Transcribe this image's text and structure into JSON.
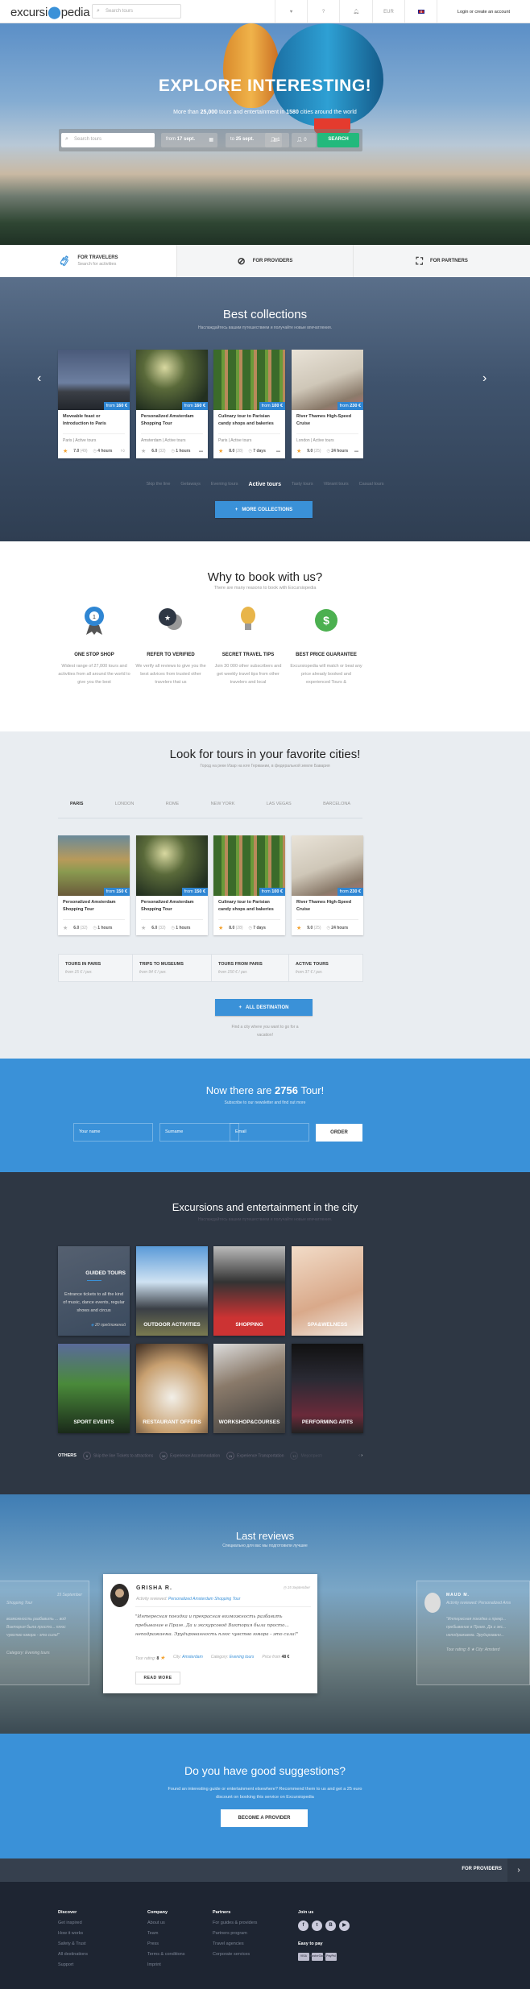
{
  "colors": {
    "accent": "#3a91d8",
    "search_button": "#23b97c",
    "dark_section": "#2e3744",
    "footer": "#1e2532",
    "star": "#f3a230"
  },
  "header": {
    "logo": "excursiopedia",
    "search_placeholder": "Search tours",
    "icons": [
      "heart-icon",
      "help-icon",
      "bell-icon"
    ],
    "currency": "EUR",
    "language_icon": "uk-flag-icon",
    "login": "Login or create an account"
  },
  "hero": {
    "title": "EXPLORE INTERESTING!",
    "subtitle_parts": [
      "More than ",
      "25,000",
      " tours and entertainment in ",
      "1580",
      " cities around the world"
    ],
    "search_placeholder": "Search tours",
    "from_label": "from",
    "from_date": "17 sept.",
    "to_label": "to",
    "to_date": "25 sept.",
    "adults": "1",
    "children": "0",
    "search_button": "SEARCH"
  },
  "tabs": [
    {
      "title": "FOR TRAVELERS",
      "sub": "Search for activities",
      "icon": "briefcase-icon",
      "active": true
    },
    {
      "title": "FOR PROVIDERS",
      "icon": "compass-icon"
    },
    {
      "title": "FOR PARTNERS",
      "icon": "frame-icon"
    }
  ],
  "collections": {
    "title": "Best collections",
    "subtitle": "Наслаждайтесь вашим путешествием и получайте новые впечатления.",
    "cards": [
      {
        "title": "Moveable feast or Introduction to Paris",
        "price_from": "from",
        "price": "160 €",
        "city": "Paris",
        "category": "Active tours",
        "rating": "7.0",
        "reviews": "(49)",
        "duration": "4 hours",
        "star_active": true
      },
      {
        "title": "Personalized Amsterdam Shopping Tour",
        "price_from": "from",
        "price": "160 €",
        "city": "Amsterdam",
        "category": "Active tours",
        "rating": "6.0",
        "reviews": "(32)",
        "duration": "1 hours",
        "star_active": false
      },
      {
        "title": "Culinary tour to Parisian candy shops and bakeries",
        "price_from": "from",
        "price": "100 €",
        "city": "Paris",
        "category": "Active tours",
        "rating": "8.0",
        "reviews": "(28)",
        "duration": "7 days",
        "star_active": true
      },
      {
        "title": "River Thames High-Speed Cruise",
        "price_from": "from",
        "price": "230 €",
        "city": "London",
        "category": "Active tours",
        "rating": "9.0",
        "reviews": "(25)",
        "duration": "24 hours",
        "star_active": true
      }
    ],
    "categories": [
      "Skip the line",
      "Getaways",
      "Evening tours",
      "Active tours",
      "Tasty tours",
      "Vibrant tours",
      "Casual tours"
    ],
    "active_category": "Active tours",
    "more_button": "MORE COLLECTIONS"
  },
  "why": {
    "title": "Why to book with us?",
    "subtitle": "There are many reasons to book with Excursiopedia",
    "items": [
      {
        "title": "ONE STOP SHOP",
        "desc": "Widest range of 27,000 tours and activities from all around the world to give you the best",
        "icon": "ribbon-badge-icon"
      },
      {
        "title": "REFER TO VERIFIED",
        "desc": "We verify all reviews to give you the best advices from trusted other travelers that us",
        "icon": "chat-star-icon"
      },
      {
        "title": "SECRET TRAVEL TIPS",
        "desc": "Join 30 000 other subscribers and get weekly travel tips from other travelers and local",
        "icon": "lightbulb-icon"
      },
      {
        "title": "BEST PRICE GUARANTEE",
        "desc": "Excursiopedia will match or beat any price already booked and experienced Tours &",
        "icon": "dollar-badge-icon"
      }
    ]
  },
  "cities": {
    "title": "Look for tours in your favorite cities!",
    "subtitle": "Город на реке Изар на юге Германии, в федеральной земле Бавария",
    "tabs": [
      "PARIS",
      "LONDON",
      "ROME",
      "NEW YORK",
      "LAS VEGAS",
      "BARCELONA"
    ],
    "active_tab": "PARIS",
    "cards": [
      {
        "title": "Personalized Amsterdam Shopping Tour",
        "price_from": "from",
        "price": "150 €",
        "rating": "6.0",
        "reviews": "(32)",
        "duration": "1 hours",
        "star_active": false
      },
      {
        "title": "Personalized Amsterdam Shopping Tour",
        "price_from": "from",
        "price": "150 €",
        "rating": "6.0",
        "reviews": "(32)",
        "duration": "1 hours",
        "star_active": false
      },
      {
        "title": "Culinary tour to Parisian candy shops and bakeries",
        "price_from": "from",
        "price": "100 €",
        "rating": "8.0",
        "reviews": "(28)",
        "duration": "7 days",
        "star_active": true
      },
      {
        "title": "River Thames High-Speed Cruise",
        "price_from": "from",
        "price": "230 €",
        "rating": "9.0",
        "reviews": "(25)",
        "duration": "24 hours",
        "star_active": true
      }
    ],
    "stats": [
      {
        "title": "TOURS IN PARIS",
        "price": "from  15 € / per."
      },
      {
        "title": "TRIPS TO MUSEUMS",
        "price": "from  94 € / per."
      },
      {
        "title": "TOURS FROM PARIS",
        "price": "from  150 € / per."
      },
      {
        "title": "ACTIVE TOURS",
        "price": "from  37 € / per."
      }
    ],
    "button": "ALL DESTINATION",
    "note": "Find a city where you want to go for a vacation!"
  },
  "newsletter": {
    "title_parts": [
      "Now there are ",
      "2756",
      " Tour!"
    ],
    "subtitle": "Subscribe to our newsletter and find out more",
    "name_placeholder": "Your name",
    "surname_placeholder": "Surname",
    "email_placeholder": "Email",
    "button": "ORDER"
  },
  "excursions": {
    "title": "Excursions and entertainment in the city",
    "subtitle": "Наслаждайтесь вашим путешествием и получайте новые впечатления.",
    "tiles": [
      {
        "label": "GUIDED TOURS",
        "desc": "Entrance tickets to all the kind of music, dance events, regular shows and circus",
        "count": "20 предложений"
      },
      {
        "label": "OUTDOOR ACTIVITIES"
      },
      {
        "label": "SHOPPING"
      },
      {
        "label": "SPA&WELNESS"
      },
      {
        "label": "SPORT EVENTS"
      },
      {
        "label": "RESTAURANT OFFERS"
      },
      {
        "label": "WORKSHOP&COURSES"
      },
      {
        "label": "PERFORMING ARTS"
      }
    ],
    "others_label": "OTHERS",
    "others": [
      {
        "num": "9",
        "label": "Skip the line Tickets to attractions"
      },
      {
        "num": "10",
        "label": "Experience Accommodation"
      },
      {
        "num": "11",
        "label": "Experience Transportation"
      },
      {
        "num": "12",
        "label": "Мероприятия"
      }
    ]
  },
  "reviews": {
    "title": "Last reviews",
    "subtitle": "Специально для вас мы подготовили лучшие",
    "main": {
      "name": "GRISHA R.",
      "date": "15 September",
      "activity_label": "Activity reviewed:",
      "activity": "Personalized Amsterdam Shopping Tour",
      "quote": "\"Интересная поездка и прекрасная возможность разбавить пребывание в Праге. Да и экскурсовод Виктория была просто... неподражаема. Эрудированность плюс чувство юмора - это сила!\"",
      "rating_label": "Tour rating:",
      "rating": "8",
      "city_label": "City:",
      "city": "Amsterdam",
      "category_label": "Category:",
      "category": "Evening tours",
      "price_label": "Price from",
      "price": "48 €",
      "button": "READ MORE"
    },
    "left": {
      "date": "15 September",
      "activity": "Shopping Tour",
      "quote": "возможность разбавить ... вод Виктория была просто... плюс чувство юмора - это сила!\"",
      "category_label": "Category:",
      "category": "Evening tours"
    },
    "right": {
      "name": "MAUD M.",
      "activity": "Activity reviewed: Personalized Ams",
      "quote": "\"Интересная поездка и прекр... пребывание в Праге. Да и экс... неподражаема. Эрудированн...",
      "rating": "Tour rating:  8 ★   City: Amsterd"
    }
  },
  "suggest": {
    "title": "Do you have good suggestions?",
    "text": "Found an interesting guide or entertainment elsewhere? Recommend them to us and get a 25 euro discount on booking this service on Excursiopedia",
    "button": "BECOME A PROVIDER"
  },
  "providers_bar": {
    "label": "FOR PROVIDERS"
  },
  "footer": {
    "columns": [
      {
        "title": "Discover",
        "links": [
          "Get inspired",
          "How it works",
          "Safety & Trust",
          "All destinations",
          "Support"
        ]
      },
      {
        "title": "Company",
        "links": [
          "About us",
          "Team",
          "Press",
          "Terms & conditions",
          "Imprint"
        ]
      },
      {
        "title": "Partners",
        "links": [
          "For guides & providers",
          "Partners program",
          "Travel agencies",
          "Corporate services"
        ]
      }
    ],
    "join_title": "Join us",
    "social": [
      {
        "icon": "facebook-icon",
        "glyph": "f"
      },
      {
        "icon": "twitter-icon",
        "glyph": "t"
      },
      {
        "icon": "vk-icon",
        "glyph": "B"
      },
      {
        "icon": "youtube-icon",
        "glyph": "▶"
      }
    ],
    "pay_title": "Easy to pay",
    "payments": [
      "VISA",
      "MasterCard",
      "PayPal"
    ]
  }
}
